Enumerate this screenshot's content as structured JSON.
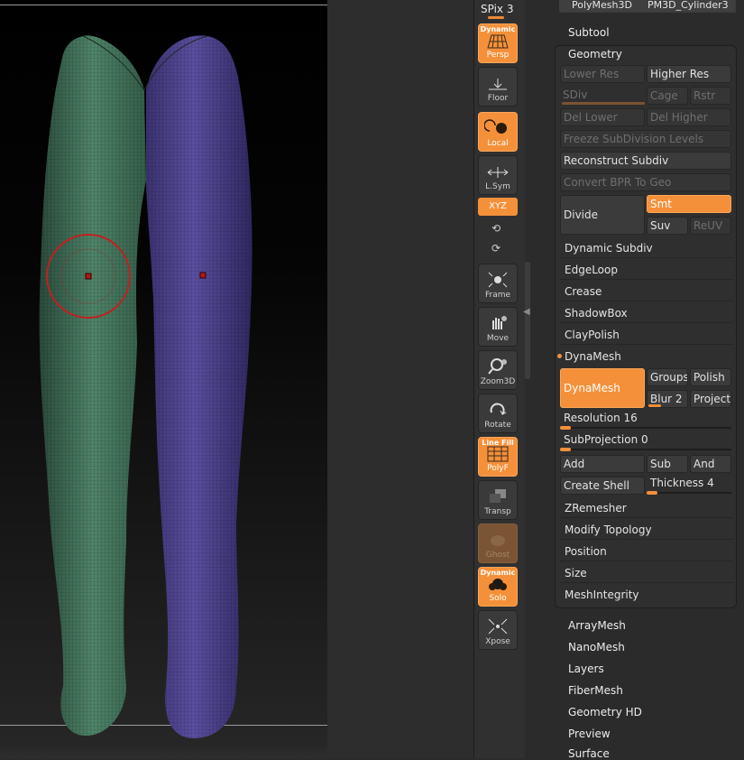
{
  "viewport": {},
  "shelf": {
    "spix_label": "SPix 3",
    "buttons": [
      {
        "id": "persp",
        "top_label": "Dynamic",
        "label": "Persp"
      },
      {
        "id": "floor",
        "top_label": "",
        "label": "Floor"
      },
      {
        "id": "local",
        "top_label": "",
        "label": "Local"
      },
      {
        "id": "lsym",
        "top_label": "",
        "label": "L.Sym"
      },
      {
        "id": "frame",
        "top_label": "",
        "label": "Frame"
      },
      {
        "id": "move",
        "top_label": "",
        "label": "Move"
      },
      {
        "id": "zoom3d",
        "top_label": "",
        "label": "Zoom3D"
      },
      {
        "id": "rotate",
        "top_label": "",
        "label": "Rotate"
      },
      {
        "id": "polyf",
        "top_label": "Line Fill",
        "label": "PolyF"
      },
      {
        "id": "transp",
        "top_label": "",
        "label": "Transp"
      },
      {
        "id": "ghost",
        "top_label": "",
        "label": "Ghost"
      },
      {
        "id": "solo",
        "top_label": "Dynamic",
        "label": "Solo"
      },
      {
        "id": "xpose",
        "top_label": "",
        "label": "Xpose"
      }
    ],
    "xyz_label": "XYZ"
  },
  "panel": {
    "top_left": "PolyMesh3D",
    "top_right": "PM3D_Cylinder3",
    "subtool": "Subtool",
    "geometry": "Geometry",
    "lower_res": "Lower Res",
    "higher_res": "Higher Res",
    "sdiv": "SDiv",
    "cage": "Cage",
    "rstr": "Rstr",
    "del_lower": "Del Lower",
    "del_higher": "Del Higher",
    "freeze": "Freeze SubDivision Levels",
    "reconstruct": "Reconstruct Subdiv",
    "convert_bpr": "Convert BPR To Geo",
    "divide": "Divide",
    "smt": "Smt",
    "suv": "Suv",
    "reuv": "ReUV",
    "sub_items_a": [
      "Dynamic Subdiv",
      "EdgeLoop",
      "Crease",
      "ShadowBox",
      "ClayPolish"
    ],
    "dynamesh_head": "DynaMesh",
    "dynamesh_btn": "DynaMesh",
    "groups": "Groups",
    "polish": "Polish",
    "blur": "Blur 2",
    "project": "Project",
    "resolution_label": "Resolution",
    "resolution_value": "16",
    "resolution_fraction": 0.03,
    "subprojection_label": "SubProjection",
    "subprojection_value": "0",
    "subprojection_fraction": 0.0,
    "add": "Add",
    "sub": "Sub",
    "and": "And",
    "create_shell": "Create Shell",
    "thickness_label": "Thickness",
    "thickness_value": "4",
    "thickness_fraction": 0.04,
    "sub_items_b": [
      "ZRemesher",
      "Modify Topology",
      "Position",
      "Size",
      "MeshIntegrity"
    ],
    "outer_items": [
      "ArrayMesh",
      "NanoMesh",
      "Layers",
      "FiberMesh",
      "Geometry HD",
      "Preview",
      "Surface"
    ]
  },
  "colors": {
    "accent": "#f5903a",
    "left_leg": "#3f6e57",
    "right_leg": "#4a3f86"
  }
}
